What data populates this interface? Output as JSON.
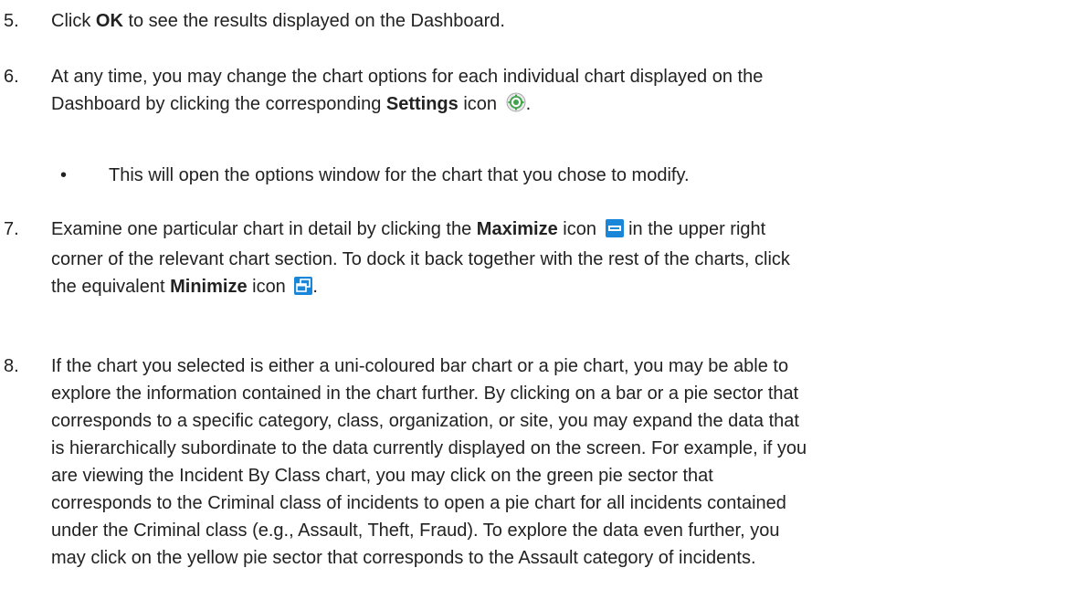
{
  "steps": {
    "s5": {
      "number": "5.",
      "t1": "Click ",
      "b1": "OK",
      "t2": " to see the results displayed on the Dashboard."
    },
    "s6": {
      "number": "6.",
      "line1": "At any time, you may change the chart options for each individual chart displayed on the",
      "line2_t1": "Dashboard by clicking the corresponding ",
      "line2_b1": "Settings",
      "line2_t2": " icon ",
      "line2_end": ".",
      "bullet": "•",
      "bullet_text": "This will open the options window for the chart that you chose to modify."
    },
    "s7": {
      "number": "7.",
      "line1_t1": "Examine one particular chart in detail by clicking the ",
      "line1_b1": "Maximize",
      "line1_t2": " icon ",
      "line1_t3": " in the upper right",
      "line2": "corner of the relevant chart section. To dock it back together with the rest of the charts, click",
      "line3_t1": "the equivalent ",
      "line3_b1": "Minimize",
      "line3_t2": " icon ",
      "line3_end": "."
    },
    "s8": {
      "number": "8.",
      "lines": [
        "If the chart you selected is either a uni-coloured bar chart or a pie chart, you may be able to",
        "explore the information contained in the chart further. By clicking on a bar or a pie sector that",
        "corresponds to a specific category, class, organization, or site, you may expand the data that",
        "is hierarchically subordinate to the data currently displayed on the screen. For example, if you",
        "are viewing the Incident By Class chart, you may click on the green pie sector that",
        "corresponds to the Criminal class of incidents to open a pie chart for all incidents contained",
        "under the Criminal class (e.g., Assault, Theft, Fraud). To explore the data even further, you",
        "may click on the yellow pie sector that corresponds to the Assault category of incidents."
      ]
    }
  },
  "icons": {
    "settings": "settings-gear-icon",
    "maximize": "maximize-window-icon",
    "minimize": "restore-window-icon"
  },
  "colors": {
    "text": "#222222",
    "settings_green": "#3fa34d",
    "window_blue": "#1a86d8"
  }
}
